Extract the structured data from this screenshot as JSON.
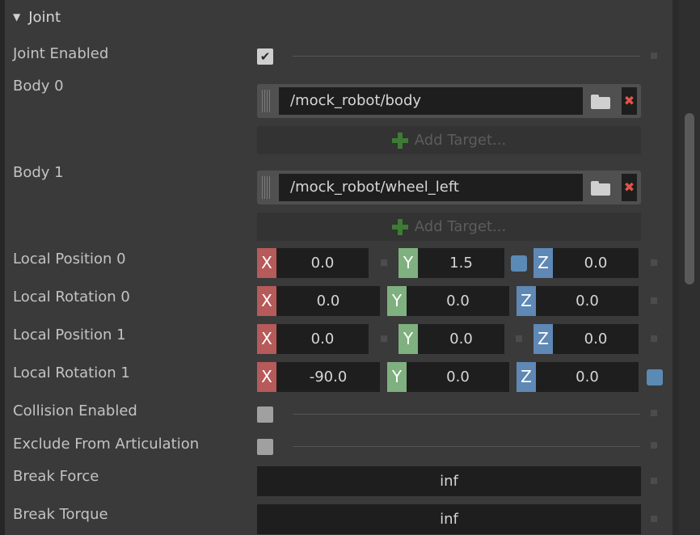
{
  "section": {
    "title": "Joint",
    "expanded": true
  },
  "labels": {
    "joint_enabled": "Joint Enabled",
    "body0": "Body 0",
    "body1": "Body 1",
    "local_position_0": "Local Position 0",
    "local_rotation_0": "Local Rotation 0",
    "local_position_1": "Local Position 1",
    "local_rotation_1": "Local Rotation 1",
    "collision_enabled": "Collision Enabled",
    "exclude_from_articulation": "Exclude From Articulation",
    "break_force": "Break Force",
    "break_torque": "Break Torque"
  },
  "joint_enabled": true,
  "collision_enabled": false,
  "exclude_from_articulation": false,
  "body0": {
    "path": "/mock_robot/body",
    "add_target": "Add Target..."
  },
  "body1": {
    "path": "/mock_robot/wheel_left",
    "add_target": "Add Target..."
  },
  "axis_labels": {
    "x": "X",
    "y": "Y",
    "z": "Z"
  },
  "local_position_0": {
    "x": "0.0",
    "y": "1.5",
    "z": "0.0"
  },
  "local_rotation_0": {
    "x": "0.0",
    "y": "0.0",
    "z": "0.0"
  },
  "local_position_1": {
    "x": "0.0",
    "y": "0.0",
    "z": "0.0"
  },
  "local_rotation_1": {
    "x": "-90.0",
    "y": "0.0",
    "z": "0.0"
  },
  "break_force": "inf",
  "break_torque": "inf",
  "icons": {
    "collapse": "triangle-down-icon",
    "check": "checkmark-icon",
    "folder": "folder-icon",
    "remove": "close-icon",
    "add": "plus-icon"
  },
  "colors": {
    "axis_x": "#b65a5a",
    "axis_y": "#7fb07f",
    "axis_z": "#5f88b4",
    "modified_marker": "#5b8ab5",
    "remove_icon": "#e0554a",
    "add_icon": "#3e7b35"
  }
}
